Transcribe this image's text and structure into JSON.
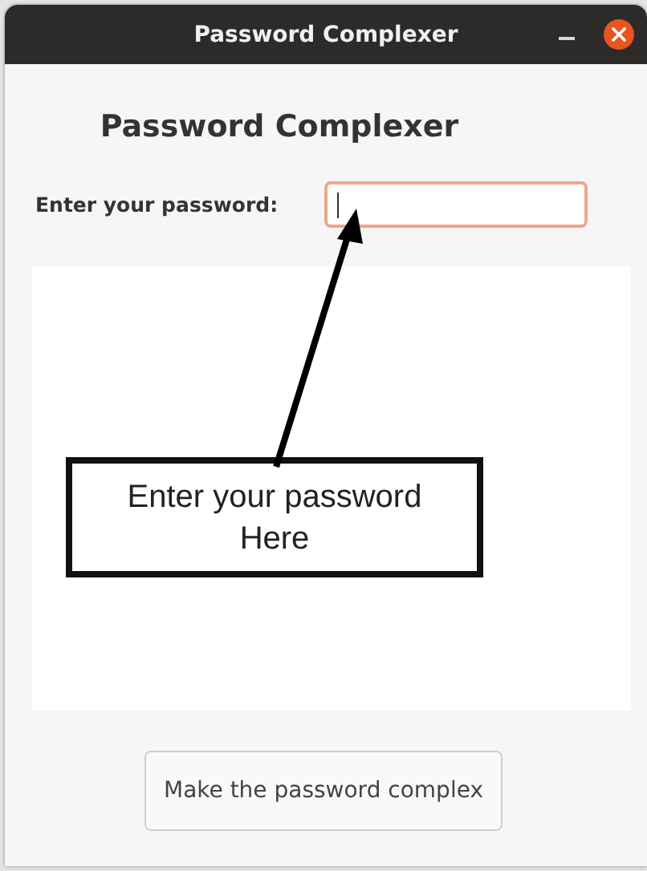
{
  "window": {
    "title": "Password Complexer"
  },
  "heading": "Password Complexer",
  "password": {
    "label": "Enter your password:",
    "focused": true
  },
  "annotation": {
    "text": "Enter your password Here"
  },
  "button": "Make the password complex"
}
